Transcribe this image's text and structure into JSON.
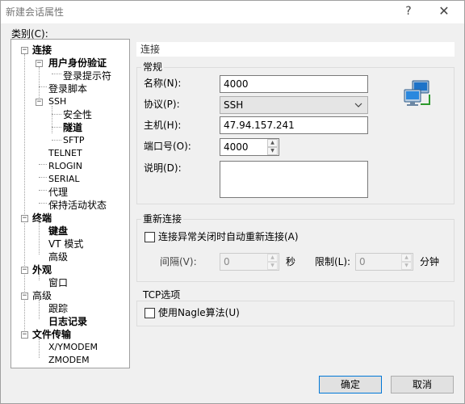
{
  "window": {
    "title": "新建会话属性",
    "help_glyph": "?",
    "close_glyph": "✕"
  },
  "category": {
    "label": "类别(C):",
    "nodes": {
      "connect": "连接",
      "user_auth": "用户身份验证",
      "login_prompt": "登录提示符",
      "login_script": "登录脚本",
      "ssh": "SSH",
      "security": "安全性",
      "tunnel": "隧道",
      "sftp": "SFTP",
      "telnet": "TELNET",
      "rlogin": "RLOGIN",
      "serial": "SERIAL",
      "proxy": "代理",
      "keepalive": "保持活动状态",
      "terminal": "终端",
      "keyboard": "键盘",
      "vt_mode": "VT 模式",
      "terminal_advanced": "高级",
      "appearance": "外观",
      "window": "窗口",
      "advanced": "高级",
      "tracking": "跟踪",
      "logging": "日志记录",
      "file_transfer": "文件传输",
      "xymodem": "X/YMODEM",
      "zmodem": "ZMODEM"
    }
  },
  "panel": {
    "header": "连接",
    "general": {
      "title": "常规",
      "name_label": "名称(N):",
      "name_value": "4000",
      "protocol_label": "协议(P):",
      "protocol_value": "SSH",
      "host_label": "主机(H):",
      "host_value": "47.94.157.241",
      "port_label": "端口号(O):",
      "port_value": "4000",
      "desc_label": "说明(D):",
      "desc_value": ""
    },
    "reconnect": {
      "title": "重新连接",
      "checkbox_label": "连接异常关闭时自动重新连接(A)",
      "interval_label": "间隔(V):",
      "interval_value": "0",
      "interval_unit": "秒",
      "limit_label": "限制(L):",
      "limit_value": "0",
      "limit_unit": "分钟"
    },
    "tcp": {
      "title": "TCP选项",
      "checkbox_label": "使用Nagle算法(U)"
    }
  },
  "footer": {
    "ok_label": "确定",
    "cancel_label": "取消"
  },
  "colors": {
    "focus_border": "#0078d7",
    "window_bg": "#f0f0f0"
  }
}
